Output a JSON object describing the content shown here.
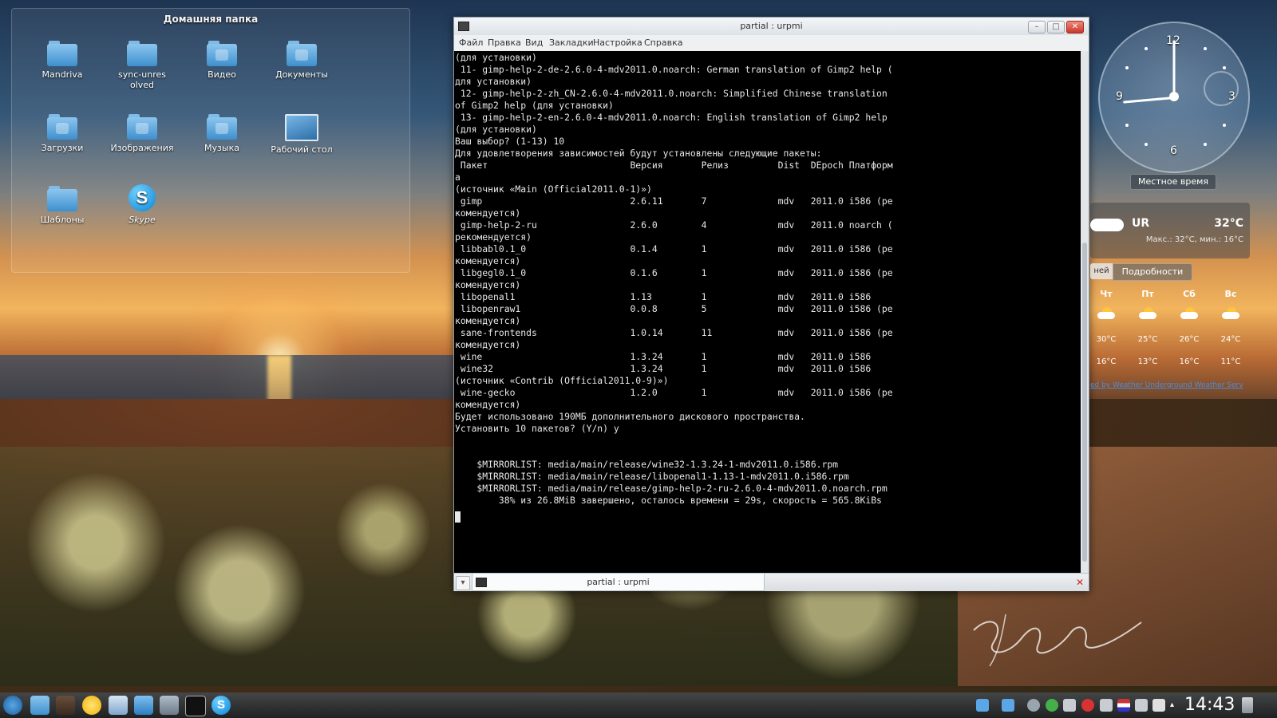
{
  "desktop": {
    "folder_view": {
      "title": "Домашняя папка",
      "items": [
        {
          "label": "Mandriva",
          "icon": "folder-icon"
        },
        {
          "label": "sync-unresolved",
          "icon": "folder-icon"
        },
        {
          "label": "Видео",
          "icon": "folder-video-icon"
        },
        {
          "label": "Документы",
          "icon": "folder-documents-icon"
        },
        {
          "label": "Загрузки",
          "icon": "folder-downloads-icon"
        },
        {
          "label": "Изображения",
          "icon": "folder-pictures-icon"
        },
        {
          "label": "Музыка",
          "icon": "folder-music-icon"
        },
        {
          "label": "Рабочий стол",
          "icon": "desktop-folder-icon"
        },
        {
          "label": "Шаблоны",
          "icon": "folder-templates-icon"
        },
        {
          "label": "Skype",
          "icon": "skype-icon"
        }
      ]
    }
  },
  "terminal_window": {
    "title": "partial : urpmi",
    "menu": [
      "Файл",
      "Правка",
      "Вид",
      "Закладки",
      "Настройка",
      "Справка"
    ],
    "lines": [
      "(для установки)",
      " 11- gimp-help-2-de-2.6.0-4-mdv2011.0.noarch: German translation of Gimp2 help (",
      "для установки)",
      " 12- gimp-help-2-zh_CN-2.6.0-4-mdv2011.0.noarch: Simplified Chinese translation",
      "of Gimp2 help (для установки)",
      " 13- gimp-help-2-en-2.6.0-4-mdv2011.0.noarch: English translation of Gimp2 help",
      "(для установки)",
      "Ваш выбор? (1-13) 10",
      "Для удовлетворения зависимостей будут установлены следующие пакеты:",
      " Пакет                          Версия       Релиз         Dist  DEpoch Платформ",
      "а",
      "(источник «Main (Official2011.0-1)»)",
      " gimp                           2.6.11       7             mdv   2011.0 i586 (ре",
      "комендуется)",
      " gimp-help-2-ru                 2.6.0        4             mdv   2011.0 noarch (",
      "рекомендуется)",
      " libbabl0.1_0                   0.1.4        1             mdv   2011.0 i586 (ре",
      "комендуется)",
      " libgegl0.1_0                   0.1.6        1             mdv   2011.0 i586 (ре",
      "комендуется)",
      " libopenal1                     1.13         1             mdv   2011.0 i586",
      " libopenraw1                    0.0.8        5             mdv   2011.0 i586 (ре",
      "комендуется)",
      " sane-frontends                 1.0.14       11            mdv   2011.0 i586 (ре",
      "комендуется)",
      " wine                           1.3.24       1             mdv   2011.0 i586",
      " wine32                         1.3.24       1             mdv   2011.0 i586",
      "(источник «Contrib (Official2011.0-9)»)",
      " wine-gecko                     1.2.0        1             mdv   2011.0 i586 (ре",
      "комендуется)",
      "Будет использовано 190МБ дополнительного дискового пространства.",
      "Установить 10 пакетов? (Y/n) y",
      "",
      "",
      "    $MIRRORLIST: media/main/release/wine32-1.3.24-1-mdv2011.0.i586.rpm",
      "    $MIRRORLIST: media/main/release/libopenal1-1.13-1-mdv2011.0.i586.rpm",
      "    $MIRRORLIST: media/main/release/gimp-help-2-ru-2.6.0-4-mdv2011.0.noarch.rpm",
      "        38% из 26.8MiB завершено, осталось времени = 29s, скорость = 565.8KiBs"
    ],
    "tab_label": "partial : urpmi"
  },
  "clock": {
    "numerals": {
      "n12": "12",
      "n3": "3",
      "n6": "6",
      "n9": "9"
    },
    "label": "Местное время"
  },
  "weather": {
    "city": "UR",
    "temp": "32°C",
    "minmax": "Макс.: 32°C, мин.: 16°C",
    "tab_left": "ней",
    "tab_details": "Подробности",
    "forecast": [
      {
        "day": "Чт",
        "high": "30°C",
        "low": "16°C"
      },
      {
        "day": "Пт",
        "high": "25°C",
        "low": "13°C"
      },
      {
        "day": "Сб",
        "high": "26°C",
        "low": "16°C"
      },
      {
        "day": "Вс",
        "high": "24°C",
        "low": "11°C"
      }
    ],
    "credit": "ed by Weather Underground Weather Serv"
  },
  "taskbar": {
    "time": "14:43"
  }
}
